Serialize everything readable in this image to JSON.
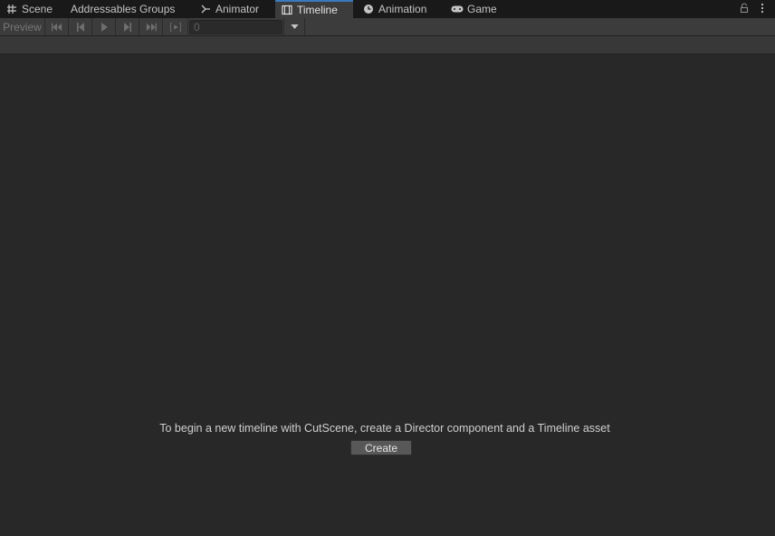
{
  "tabs": [
    {
      "label": "Scene",
      "icon": "grid-icon"
    },
    {
      "label": "Addressables Groups",
      "icon": ""
    },
    {
      "label": "Animator",
      "icon": "animator-icon"
    },
    {
      "label": "Timeline",
      "icon": "film-icon",
      "active": true
    },
    {
      "label": "Animation",
      "icon": "clock-icon"
    },
    {
      "label": "Game",
      "icon": "gamepad-icon"
    }
  ],
  "toolbar": {
    "preview_label": "Preview",
    "current_frame": "0",
    "buttons": [
      "go-to-first-frame",
      "previous-frame",
      "play",
      "next-frame",
      "go-to-last-frame",
      "play-range"
    ]
  },
  "main": {
    "message": "To begin a new timeline with CutScene, create a Director component and a Timeline asset",
    "create_label": "Create"
  },
  "colors": {
    "background": "#282828",
    "tabbar": "#191919",
    "toolbar": "#3c3c3c",
    "active_tab_accent": "#3a79bb",
    "button": "#585858"
  }
}
